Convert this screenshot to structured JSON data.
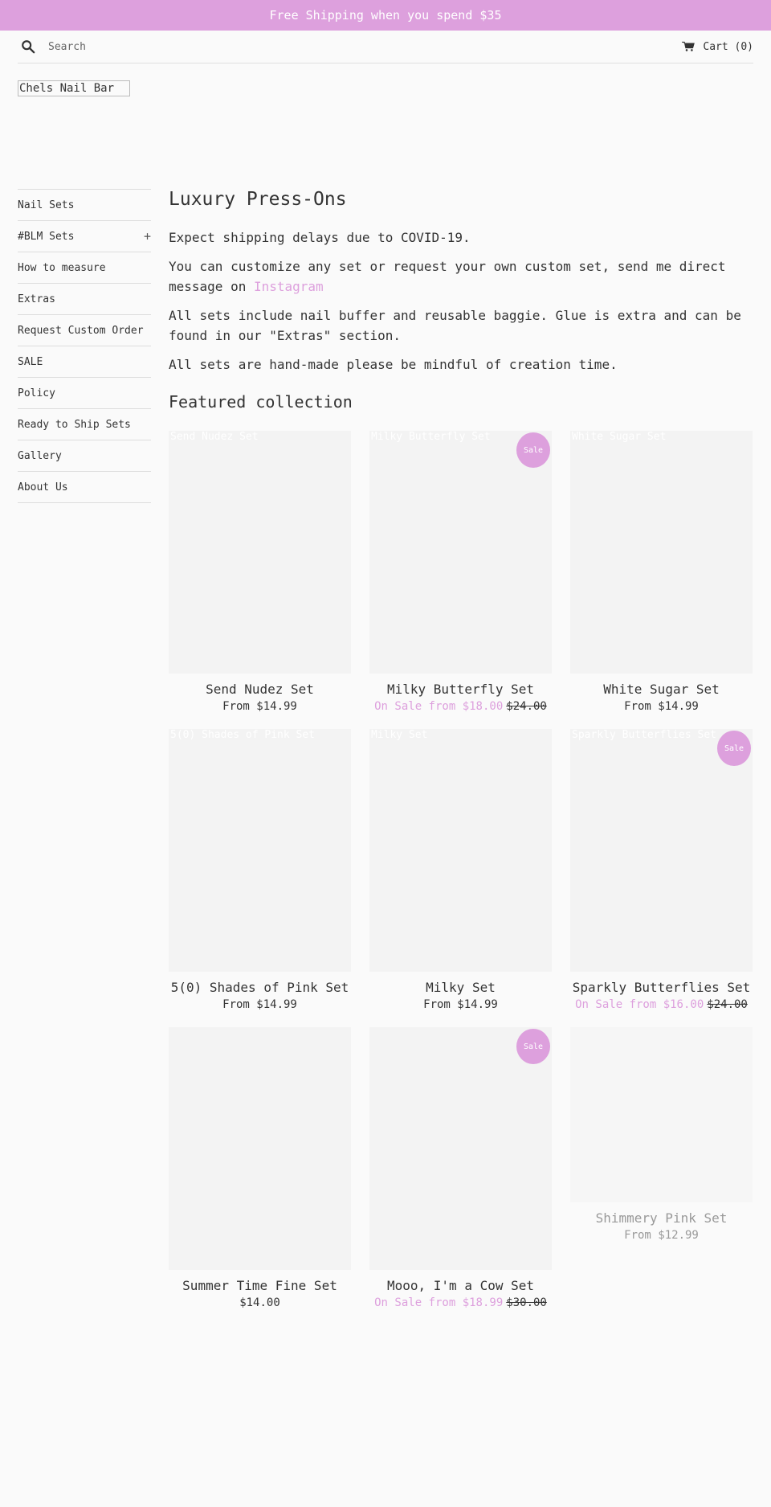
{
  "announcement": "Free Shipping when you spend $35",
  "search": {
    "placeholder": "Search"
  },
  "cart": {
    "label": "Cart (0)"
  },
  "logo_text": "Chels Nail Bar",
  "sidebar": {
    "items": [
      {
        "label": "Nail Sets"
      },
      {
        "label": "#BLM Sets",
        "expander": "+"
      },
      {
        "label": "How to measure"
      },
      {
        "label": "Extras"
      },
      {
        "label": "Request Custom Order"
      },
      {
        "label": "SALE"
      },
      {
        "label": "Policy"
      },
      {
        "label": "Ready to Ship Sets"
      },
      {
        "label": "Gallery"
      },
      {
        "label": "About Us"
      }
    ]
  },
  "main": {
    "title": "Luxury Press-Ons",
    "p1": "Expect shipping delays due to COVID-19.",
    "p2_text": "You can customize any set or request your own custom set, send me direct message on ",
    "p2_link": "Instagram",
    "p3": "All sets include nail buffer and reusable baggie. Glue is extra and can be found in our \"Extras\" section.",
    "p4": "All sets are hand-made please be mindful of creation time.",
    "featured_title": "Featured collection"
  },
  "products": [
    {
      "alt": "Send Nudez Set",
      "title": "Send Nudez Set",
      "price": "From $14.99"
    },
    {
      "alt": "Milky Butterfly Set",
      "title": "Milky Butterfly Set",
      "badge": "Sale",
      "sale_price": "On Sale from $18.00",
      "compare": "$24.00"
    },
    {
      "alt": "White Sugar Set",
      "title": "White Sugar Set",
      "price": "From $14.99"
    },
    {
      "alt": "5(0) Shades of Pink Set",
      "title": "5(0) Shades of Pink Set",
      "price": "From $14.99"
    },
    {
      "alt": "Milky Set",
      "title": "Milky Set",
      "price": "From $14.99"
    },
    {
      "alt": "Sparkly Butterflies Set",
      "title": "Sparkly Butterflies Set",
      "badge": "Sale",
      "sale_price": "On Sale from $16.00",
      "compare": "$24.00"
    },
    {
      "title": "Summer Time Fine Set",
      "price": "$14.00"
    },
    {
      "title": "Mooo, I'm a Cow Set",
      "badge": "Sale",
      "sale_price": "On Sale from $18.99",
      "compare": "$30.00"
    },
    {
      "title": "Shimmery Pink Set",
      "price": "From $12.99"
    }
  ]
}
